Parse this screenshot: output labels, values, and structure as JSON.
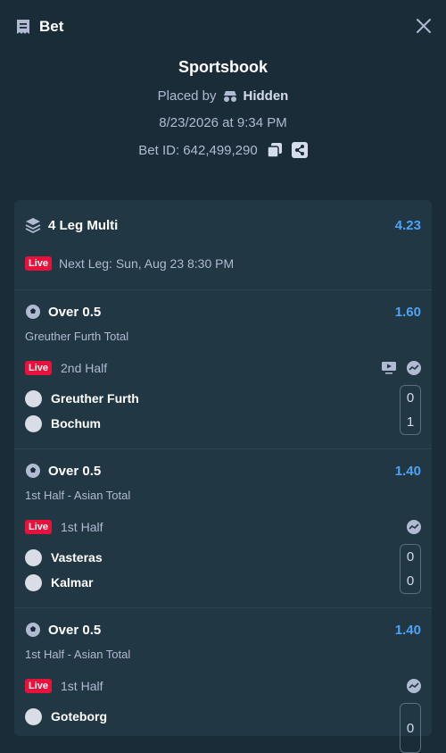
{
  "header": {
    "title": "Bet",
    "receipt_icon": "receipt-icon",
    "close_icon": "close-icon"
  },
  "info": {
    "book": "Sportsbook",
    "placed_by_label": "Placed by",
    "placed_by_name": "Hidden",
    "datetime": "8/23/2026 at 9:34 PM",
    "bet_id": "Bet ID: 642,499,290"
  },
  "multi": {
    "name": "4 Leg Multi",
    "odds": "4.23",
    "live_badge": "Live",
    "next_leg": "Next Leg: Sun, Aug 23 8:30 PM"
  },
  "legs": [
    {
      "selection": "Over 0.5",
      "odds": "1.60",
      "market": "Greuther Furth Total",
      "live_badge": "Live",
      "period": "2nd Half",
      "teams": [
        {
          "name": "Greuther Furth",
          "score": "0"
        },
        {
          "name": "Bochum",
          "score": "1"
        }
      ]
    },
    {
      "selection": "Over 0.5",
      "odds": "1.40",
      "market": "1st Half - Asian Total",
      "live_badge": "Live",
      "period": "1st Half",
      "teams": [
        {
          "name": "Vasteras",
          "score": "0"
        },
        {
          "name": "Kalmar",
          "score": "0"
        }
      ]
    },
    {
      "selection": "Over 0.5",
      "odds": "1.40",
      "market": "1st Half - Asian Total",
      "live_badge": "Live",
      "period": "1st Half",
      "teams": [
        {
          "name": "Goteborg",
          "score": "0"
        }
      ]
    }
  ],
  "colors": {
    "background": "#1a2c38",
    "card": "#213743",
    "accent_odds": "#4da3f5",
    "live": "#e9113c"
  }
}
